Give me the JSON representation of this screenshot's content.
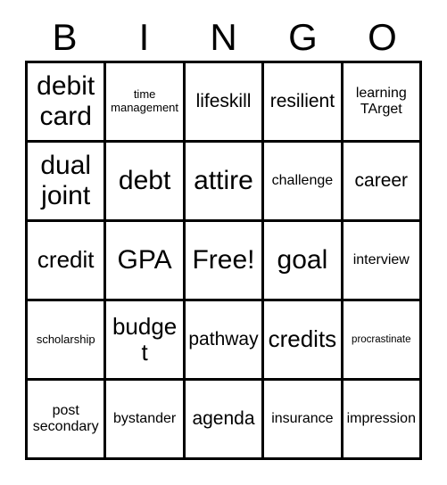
{
  "card": {
    "title": "BINGO",
    "headers": [
      "B",
      "I",
      "N",
      "G",
      "O"
    ],
    "free_space_label": "Free!",
    "colors": {
      "background": "#ffffff",
      "text": "#000000",
      "grid_line": "#000000"
    },
    "rows": [
      [
        {
          "text": "debit card",
          "size": "xl"
        },
        {
          "text": "time management",
          "size": "xs"
        },
        {
          "text": "lifeskill",
          "size": "md"
        },
        {
          "text": "resilient",
          "size": "md"
        },
        {
          "text": "learning TArget",
          "size": "sm"
        }
      ],
      [
        {
          "text": "dual joint",
          "size": "xl"
        },
        {
          "text": "debt",
          "size": "xl"
        },
        {
          "text": "attire",
          "size": "xl"
        },
        {
          "text": "challenge",
          "size": "sm"
        },
        {
          "text": "career",
          "size": "md"
        }
      ],
      [
        {
          "text": "credit",
          "size": "lg"
        },
        {
          "text": "GPA",
          "size": "xl"
        },
        {
          "text": "Free!",
          "size": "xl"
        },
        {
          "text": "goal",
          "size": "xl"
        },
        {
          "text": "interview",
          "size": "sm"
        }
      ],
      [
        {
          "text": "scholarship",
          "size": "xs"
        },
        {
          "text": "budget",
          "size": "lg"
        },
        {
          "text": "pathway",
          "size": "md"
        },
        {
          "text": "credits",
          "size": "lg"
        },
        {
          "text": "procrastinate",
          "size": "xxs"
        }
      ],
      [
        {
          "text": "post secondary",
          "size": "sm"
        },
        {
          "text": "bystander",
          "size": "sm"
        },
        {
          "text": "agenda",
          "size": "md"
        },
        {
          "text": "insurance",
          "size": "sm"
        },
        {
          "text": "impression",
          "size": "sm"
        }
      ]
    ]
  }
}
